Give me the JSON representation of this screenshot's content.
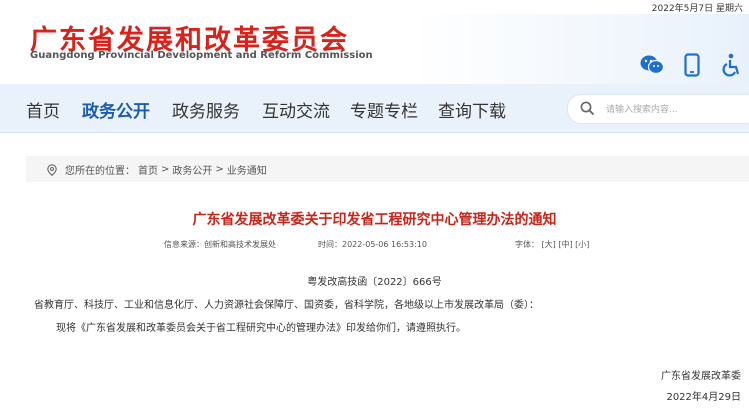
{
  "topbar": {
    "date": "2022年5月7日 星期六"
  },
  "header": {
    "title_cn": "广东省发展和改革委员会",
    "title_en": "Guangdong Provincial Development and Reform Commission",
    "icons": [
      "wechat-icon",
      "mobile-icon",
      "accessibility-icon"
    ]
  },
  "nav": {
    "items": [
      "首页",
      "政务公开",
      "政务服务",
      "互动交流",
      "专题专栏",
      "查询下载"
    ],
    "active": "政务公开",
    "search_placeholder": "请输入搜索内容..."
  },
  "breadcrumb": {
    "prefix": "您所在的位置：",
    "items": [
      "首页",
      "政务公开",
      "业务通知"
    ],
    "separator": ">"
  },
  "article": {
    "title": "广东省发展改革委关于印发省工程研究中心管理办法的通知",
    "source": "信息来源：创新和高技术发展处",
    "time": "时间：2022-05-06 16:53:10",
    "font_label": "字体：",
    "font_sizes": [
      "[大]",
      "[中]",
      "[小]"
    ],
    "doc_no": "粤发改高技函〔2022〕666号",
    "addressee": "省教育厅、科技厅、工业和信息化厅、人力资源社会保障厅、国资委，省科学院，各地级以上市发展改革局（委）：",
    "body": "现将《广东省发展和改革委员会关于省工程研究中心的管理办法》印发给你们，请遵照执行。",
    "signer": "广东省发展改革委",
    "sign_date": "2022年4月29日"
  }
}
